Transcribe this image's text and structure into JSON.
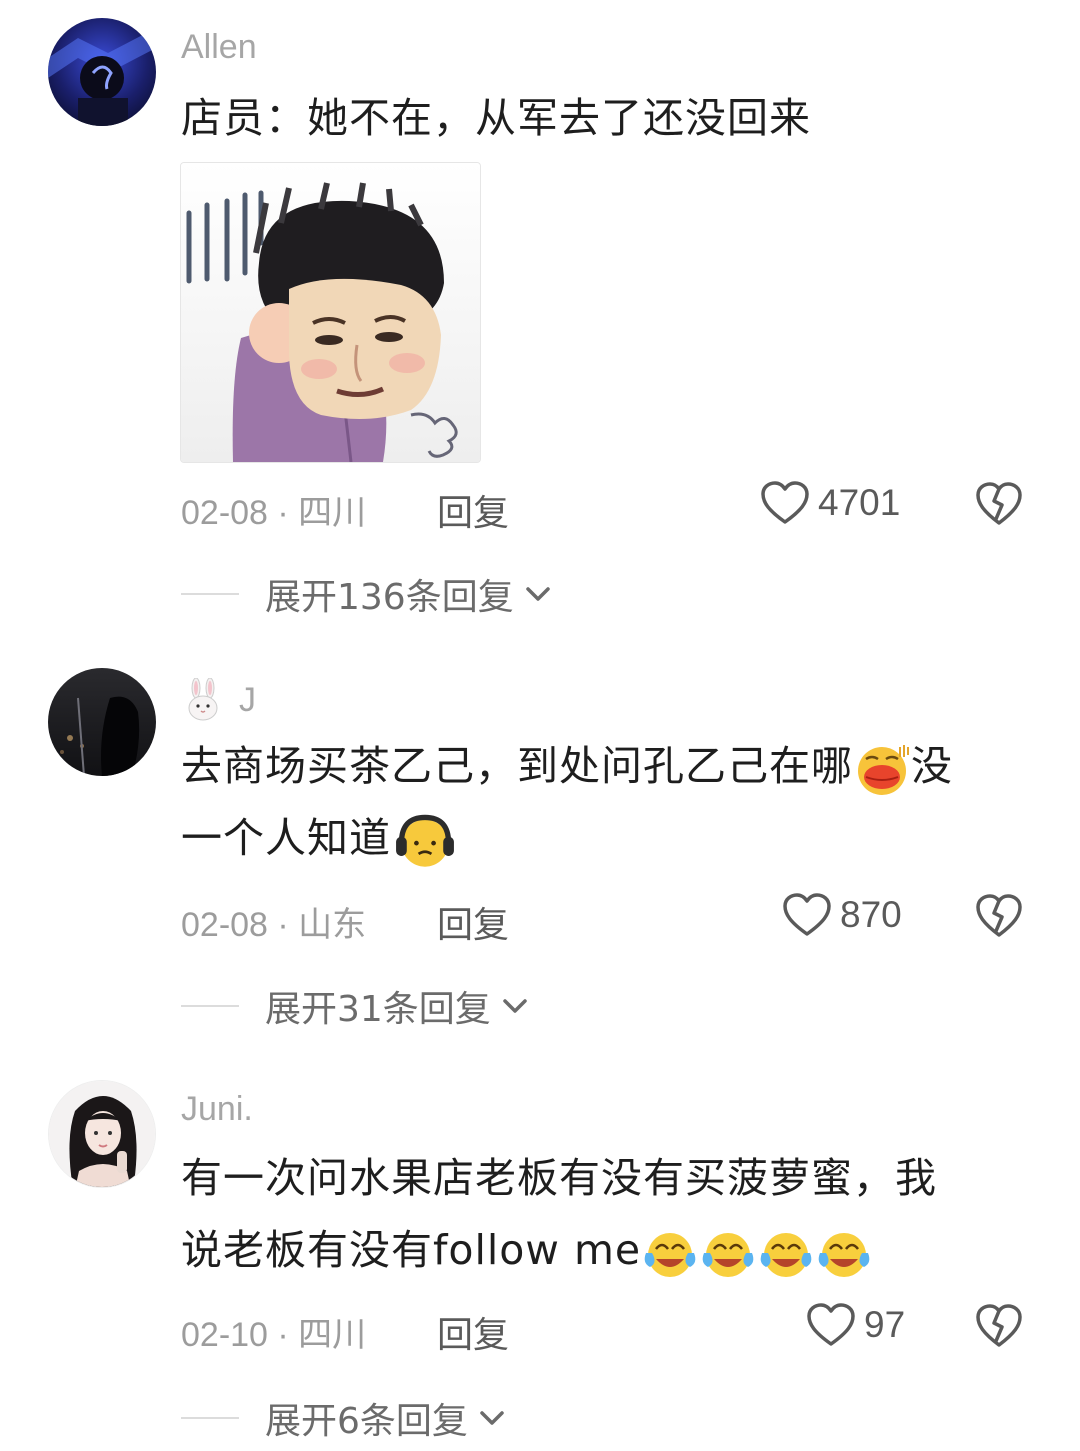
{
  "comments": [
    {
      "username": "Allen",
      "text": "店员：她不在，从军去了还没回来",
      "date_location": "02-08 · 四川",
      "reply_label": "回复",
      "likes": "4701",
      "expand_label": "展开136条回复"
    },
    {
      "username_icon": "rabbit-emoji",
      "username": "J",
      "text_line1": "去商场买茶乙己，到处问孔乙己在哪",
      "text_line1_end": "没",
      "text_line2": "一个人知道",
      "date_location": "02-08 · 山东",
      "reply_label": "回复",
      "likes": "870",
      "expand_label": "展开31条回复"
    },
    {
      "username": "Juni.",
      "text_line1": "有一次问水果店老板有没有买菠萝蜜，我",
      "text_line2": "说老板有没有follow me",
      "date_location": "02-10 · 四川",
      "reply_label": "回复",
      "likes": "97",
      "expand_label": "展开6条回复"
    }
  ],
  "colors": {
    "username": "#a6a6a6",
    "body_text": "#1e1e1e",
    "meta": "#9c9c9c",
    "action": "#5a5a5a"
  }
}
